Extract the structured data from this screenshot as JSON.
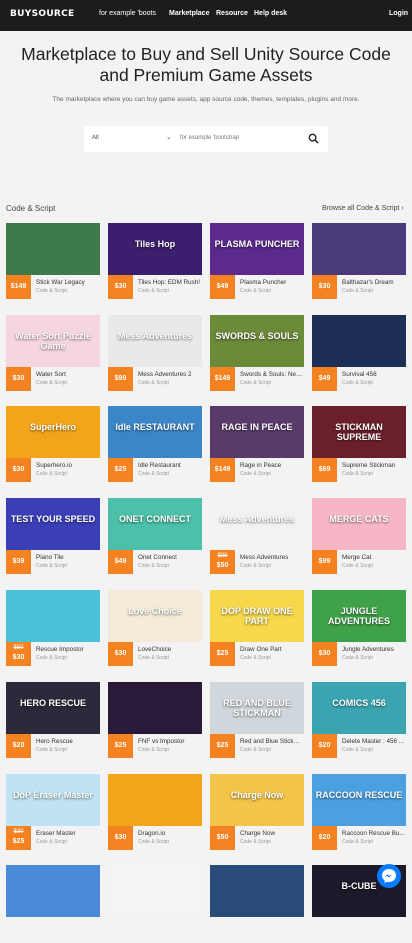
{
  "header": {
    "logo": "BUYSOURCE",
    "search_placeholder": "for example 'boots",
    "nav": [
      "Marketplace",
      "Resource",
      "Help desk"
    ],
    "login": "Login"
  },
  "hero": {
    "title": "Marketplace to Buy and Sell Unity Source Code and Premium Game Assets",
    "subtitle": "The marketplace where you can buy game assets, app source code, themes, templates, plugins and more.",
    "search": {
      "category": "All",
      "placeholder": "for example 'bootstrap"
    }
  },
  "section": {
    "title": "Code & Script",
    "browse": "Browse all Code & Script"
  },
  "colors": {
    "accent": "#f58220",
    "topbar": "#1c1c1e"
  },
  "products": [
    {
      "title": "Stick War Legacy",
      "category": "Code & Script",
      "price": "$149",
      "thumb_color": "#3f7b4a",
      "thumb_label": ""
    },
    {
      "title": "Tiles Hop: EDM Rush!",
      "category": "Code & Script",
      "price": "$30",
      "thumb_color": "#3c1e6e",
      "thumb_label": "Tiles Hop"
    },
    {
      "title": "Plasma Puncher",
      "category": "Code & Script",
      "price": "$49",
      "thumb_color": "#5b2a8c",
      "thumb_label": "PLASMA PUNCHER"
    },
    {
      "title": "Balthazar's Dream",
      "category": "Code & Script",
      "price": "$30",
      "thumb_color": "#4a3a7a",
      "thumb_label": ""
    },
    {
      "title": "Water Sort",
      "category": "Code & Script",
      "price": "$30",
      "thumb_color": "#f5d6df",
      "thumb_label": "Water Sort Puzzle Game"
    },
    {
      "title": "Mess Adventures 2",
      "category": "Code & Script",
      "price": "$99",
      "thumb_color": "#e9e9e9",
      "thumb_label": "Mess Adventures"
    },
    {
      "title": "Swords & Souls: Neve...",
      "category": "Code & Script",
      "price": "$149",
      "thumb_color": "#6b8a3a",
      "thumb_label": "SWORDS & SOULS"
    },
    {
      "title": "Survival 456",
      "category": "Code & Script",
      "price": "$49",
      "thumb_color": "#1d2f55",
      "thumb_label": ""
    },
    {
      "title": "Superhero.io",
      "category": "Code & Script",
      "price": "$30",
      "thumb_color": "#f2a51a",
      "thumb_label": "SuperHero"
    },
    {
      "title": "Idle Restaurant",
      "category": "Code & Script",
      "price": "$25",
      "thumb_color": "#3a86c8",
      "thumb_label": "Idle RESTAURANT"
    },
    {
      "title": "Rage in Peace",
      "category": "Code & Script",
      "price": "$149",
      "thumb_color": "#5a3a6a",
      "thumb_label": "RAGE IN PEACE"
    },
    {
      "title": "Supreme Stickman",
      "category": "Code & Script",
      "price": "$69",
      "thumb_color": "#6a1f2a",
      "thumb_label": "STICKMAN SUPREME"
    },
    {
      "title": "Piano Tile",
      "category": "Code & Script",
      "price": "$39",
      "thumb_color": "#3a3fb8",
      "thumb_label": "TEST YOUR SPEED"
    },
    {
      "title": "Onet Connect",
      "category": "Code & Script",
      "price": "$49",
      "thumb_color": "#4cc0a8",
      "thumb_label": "ONET CONNECT"
    },
    {
      "title": "Mess Adventures",
      "category": "Code & Script",
      "price_old": "$99",
      "price": "$50",
      "thumb_color": "#f2f2f2",
      "thumb_label": "Mess Adventures"
    },
    {
      "title": "Merge Cat",
      "category": "Code & Script",
      "price": "$99",
      "thumb_color": "#f7b6c6",
      "thumb_label": "MERGE CATS"
    },
    {
      "title": "Rescue Impostor",
      "category": "Code & Script",
      "price_old": "$50",
      "price": "$30",
      "thumb_color": "#4bc0d9",
      "thumb_label": ""
    },
    {
      "title": "LoveChoice",
      "category": "Code & Script",
      "price": "$30",
      "thumb_color": "#f4ecd8",
      "thumb_label": "Love Choice"
    },
    {
      "title": "Draw One Part",
      "category": "Code & Script",
      "price": "$25",
      "thumb_color": "#f6d84a",
      "thumb_label": "DOP DRAW ONE PART"
    },
    {
      "title": "Jungle Adventures",
      "category": "Code & Script",
      "price": "$30",
      "thumb_color": "#3fa24a",
      "thumb_label": "JUNGLE ADVENTURES"
    },
    {
      "title": "Hero Rescue",
      "category": "Code & Script",
      "price": "$20",
      "thumb_color": "#2a2a3a",
      "thumb_label": "HERO RESCUE"
    },
    {
      "title": "FNF vs Impostor",
      "category": "Code & Script",
      "price": "$25",
      "thumb_color": "#2a1a3a",
      "thumb_label": ""
    },
    {
      "title": "Red and Blue Stickm...",
      "category": "Code & Script",
      "price": "$25",
      "thumb_color": "#cfd6dc",
      "thumb_label": "RED AND BLUE STICKMAN"
    },
    {
      "title": "Delete Master : 456 ...",
      "category": "Code & Script",
      "price": "$20",
      "thumb_color": "#3aa5b0",
      "thumb_label": "COMICS 456"
    },
    {
      "title": "Eraser Master",
      "category": "Code & Script",
      "price_old": "$30",
      "price": "$25",
      "thumb_color": "#bfe3f2",
      "thumb_label": "DoP Eraser Master"
    },
    {
      "title": "Dragon.io",
      "category": "Code & Script",
      "price": "$30",
      "thumb_color": "#f2a51a",
      "thumb_label": ""
    },
    {
      "title": "Charge Now",
      "category": "Code & Script",
      "price": "$50",
      "thumb_color": "#f2c54a",
      "thumb_label": "Charge Now"
    },
    {
      "title": "Raccoon Rescue Bu...",
      "category": "Code & Script",
      "price": "$20",
      "thumb_color": "#4aa0e0",
      "thumb_label": "RACCOON RESCUE"
    },
    {
      "title": "",
      "category": "",
      "price": "",
      "thumb_color": "#4a8ad8",
      "thumb_label": ""
    },
    {
      "title": "",
      "category": "",
      "price": "",
      "thumb_color": "#f4f4f4",
      "thumb_label": ""
    },
    {
      "title": "",
      "category": "",
      "price": "",
      "thumb_color": "#2a4a7a",
      "thumb_label": ""
    },
    {
      "title": "",
      "category": "",
      "price": "",
      "thumb_color": "#1a1a2a",
      "thumb_label": "B-CUBE"
    }
  ]
}
